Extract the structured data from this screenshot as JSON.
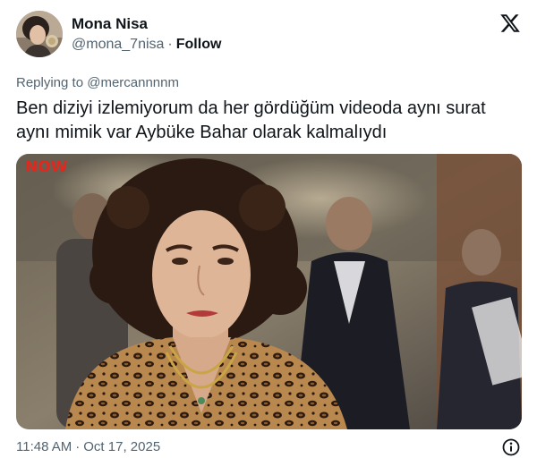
{
  "author": {
    "name": "Mona Nisa",
    "handle": "@mona_7nisa",
    "separator": "·",
    "follow_label": "Follow",
    "avatar_icon": "profile-photo"
  },
  "brand_icon": "x-logo-icon",
  "reply": {
    "prefix": "Replying to",
    "mention": "@mercannnnm"
  },
  "tweet": {
    "text": "Ben diziyi izlemiyorum da her gördüğüm videoda aynı surat aynı mimik var Aybüke Bahar olarak kalmalıydı"
  },
  "media": {
    "watermark": "NOW",
    "watermark_color": "#e0281e"
  },
  "meta": {
    "time": "11:48 AM",
    "separator": "·",
    "date": "Oct 17, 2025",
    "info_icon": "info-icon"
  },
  "colors": {
    "text_primary": "#0f1419",
    "text_secondary": "#536471"
  }
}
